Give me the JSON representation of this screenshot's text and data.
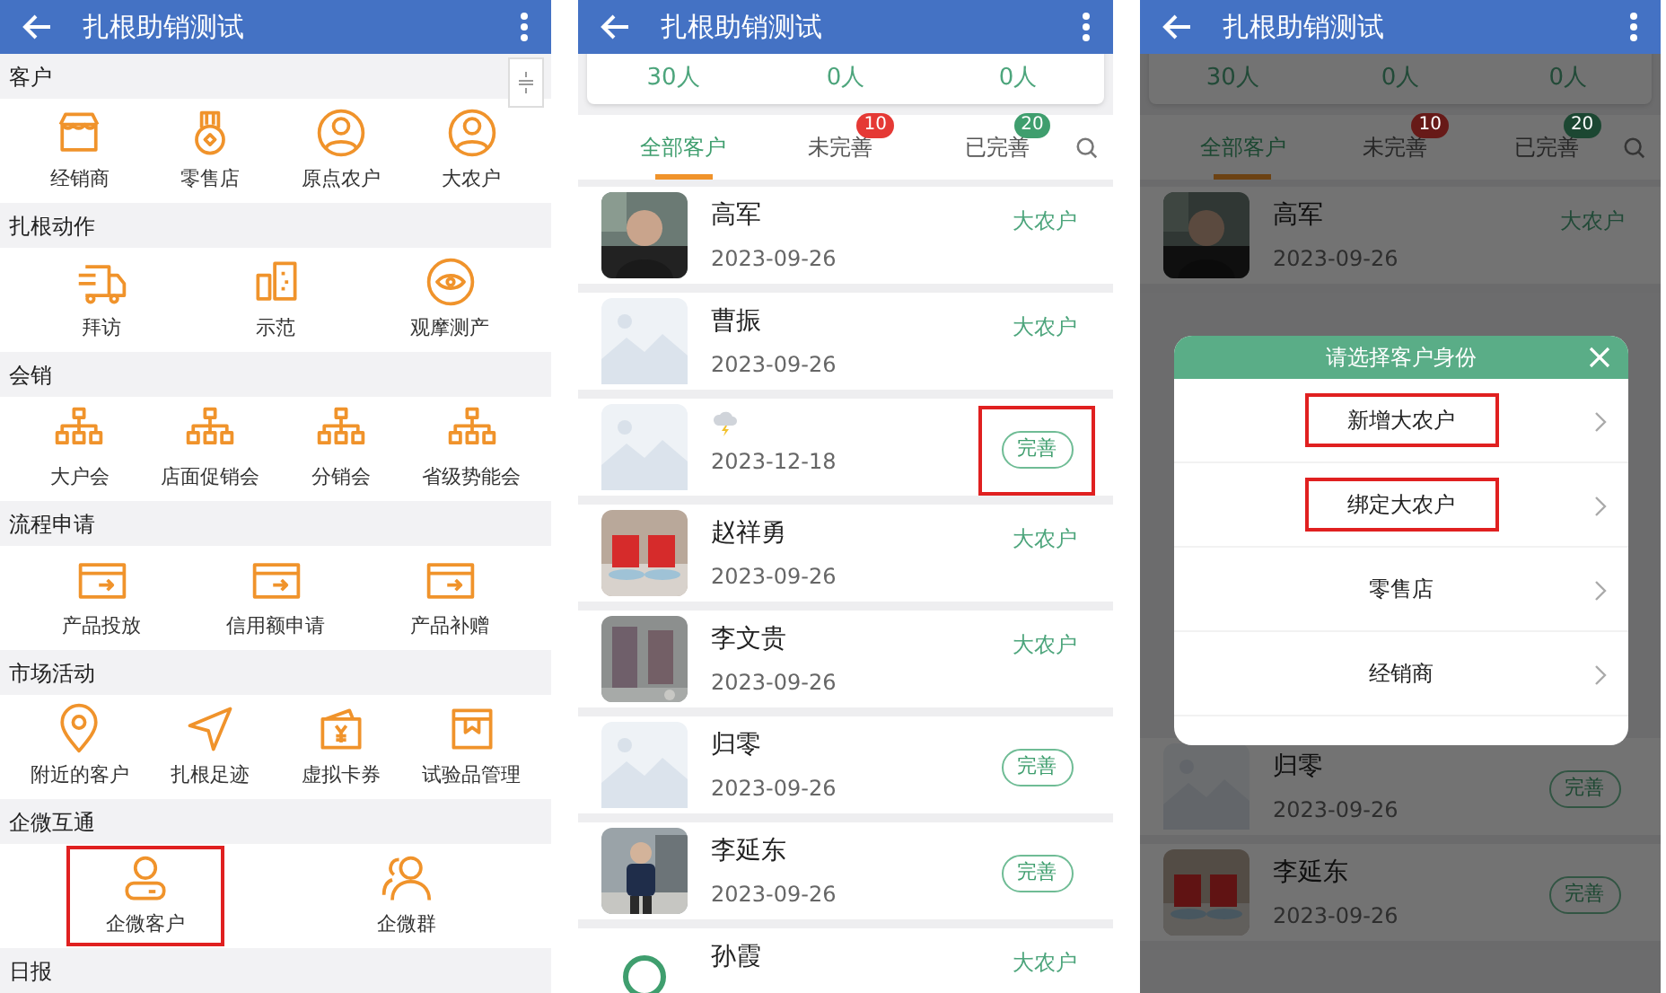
{
  "screens": [
    {
      "kind": "menu",
      "title": "扎根助销测试",
      "sections": [
        {
          "heading": "客户",
          "items": [
            {
              "label": "经销商",
              "kind": "shop",
              "highlighted": false
            },
            {
              "label": "零售店",
              "kind": "medal",
              "highlighted": false
            },
            {
              "label": "原点农户",
              "kind": "user-circle",
              "highlighted": false
            },
            {
              "label": "大农户",
              "kind": "user-circle",
              "highlighted": false
            }
          ]
        },
        {
          "heading": "扎根动作",
          "items": [
            {
              "label": "拜访",
              "kind": "truck",
              "highlighted": false
            },
            {
              "label": "示范",
              "kind": "buildings",
              "highlighted": false
            },
            {
              "label": "观摩测产",
              "kind": "eye",
              "highlighted": false
            }
          ]
        },
        {
          "heading": "会销",
          "items": [
            {
              "label": "大户会",
              "kind": "hierarchy",
              "highlighted": false
            },
            {
              "label": "店面促销会",
              "kind": "hierarchy",
              "highlighted": false
            },
            {
              "label": "分销会",
              "kind": "hierarchy",
              "highlighted": false
            },
            {
              "label": "省级势能会",
              "kind": "hierarchy",
              "highlighted": false
            }
          ]
        },
        {
          "heading": "流程申请",
          "items": [
            {
              "label": "产品投放",
              "kind": "folder",
              "highlighted": false
            },
            {
              "label": "信用额申请",
              "kind": "folder",
              "highlighted": false
            },
            {
              "label": "产品补赠",
              "kind": "folder",
              "highlighted": false
            }
          ]
        },
        {
          "heading": "市场活动",
          "items": [
            {
              "label": "附近的客户",
              "kind": "pin",
              "highlighted": false
            },
            {
              "label": "扎根足迹",
              "kind": "send",
              "highlighted": false
            },
            {
              "label": "虚拟卡券",
              "kind": "wallet",
              "highlighted": false
            },
            {
              "label": "试验品管理",
              "kind": "box",
              "highlighted": false
            }
          ]
        },
        {
          "heading": "企微互通",
          "items": [
            {
              "label": "企微客户",
              "kind": "user",
              "highlighted": true
            },
            {
              "label": "企微群",
              "kind": "users",
              "highlighted": false
            }
          ]
        },
        {
          "heading": "日报"
        }
      ]
    },
    {
      "kind": "list",
      "title": "扎根助销测试",
      "stats": [
        "30人",
        "0人",
        "0人"
      ],
      "tabs": [
        {
          "label": "全部客户",
          "selected": true
        },
        {
          "label": "未完善",
          "selected": false,
          "badge": "10",
          "color": "#e53935"
        },
        {
          "label": "已完善",
          "selected": false,
          "badge": "20",
          "color": "#3f9e6e"
        }
      ],
      "rows": [
        {
          "kind": "name",
          "name": "高军",
          "date": "2023-09-26",
          "tag": "大农户"
        },
        {
          "kind": "name",
          "avatar": {
            "kind": "placeholder"
          },
          "name": "曹振",
          "date": "2023-09-26",
          "tag": "大农户"
        },
        {
          "kind": "weather",
          "avatar": {
            "kind": "placeholder"
          },
          "date": "2023-12-18",
          "button": "完善",
          "highlighted": true
        },
        {
          "kind": "name",
          "name": "赵祥勇",
          "date": "2023-09-26",
          "tag": "大农户"
        },
        {
          "kind": "name",
          "name": "李文贵",
          "date": "2023-09-26",
          "tag": "大农户"
        },
        {
          "kind": "name",
          "avatar": {
            "kind": "placeholder"
          },
          "name": "归零",
          "date": "2023-09-26",
          "button": "完善",
          "highlighted": false
        },
        {
          "kind": "name",
          "name": "李延东",
          "date": "2023-09-26",
          "button": "完善",
          "highlighted": false
        },
        {
          "kind": "name",
          "avatar": {
            "kind": "ring"
          },
          "name": "孙霞",
          "tag": "大农户"
        }
      ]
    },
    {
      "kind": "dialog",
      "title": "扎根助销测试",
      "stats": [
        "30人",
        "0人",
        "0人"
      ],
      "tabs": [
        {
          "label": "全部客户",
          "selected": true
        },
        {
          "label": "未完善",
          "selected": false,
          "badge": "10",
          "color": "#671a18"
        },
        {
          "label": "已完善",
          "selected": false,
          "badge": "20",
          "color": "#1c4732"
        }
      ],
      "rows": [
        {
          "kind": "name",
          "name": "高军",
          "date": "2023-09-26",
          "tag": "大农户"
        },
        {
          "kind": "name",
          "avatar": {
            "kind": "placeholder"
          },
          "name": "归零",
          "date": "2023-09-26",
          "button": "完善",
          "highlighted": false
        },
        {
          "kind": "name",
          "name": "李延东",
          "date": "2023-09-26",
          "button": "完善",
          "highlighted": false
        }
      ],
      "dialog": {
        "title": "请选择客户身份",
        "options": [
          {
            "label": "新增大农户",
            "highlighted": true
          },
          {
            "label": "绑定大农户",
            "highlighted": true
          },
          {
            "label": "零售店",
            "highlighted": false
          },
          {
            "label": "经销商",
            "highlighted": false
          }
        ]
      }
    }
  ]
}
